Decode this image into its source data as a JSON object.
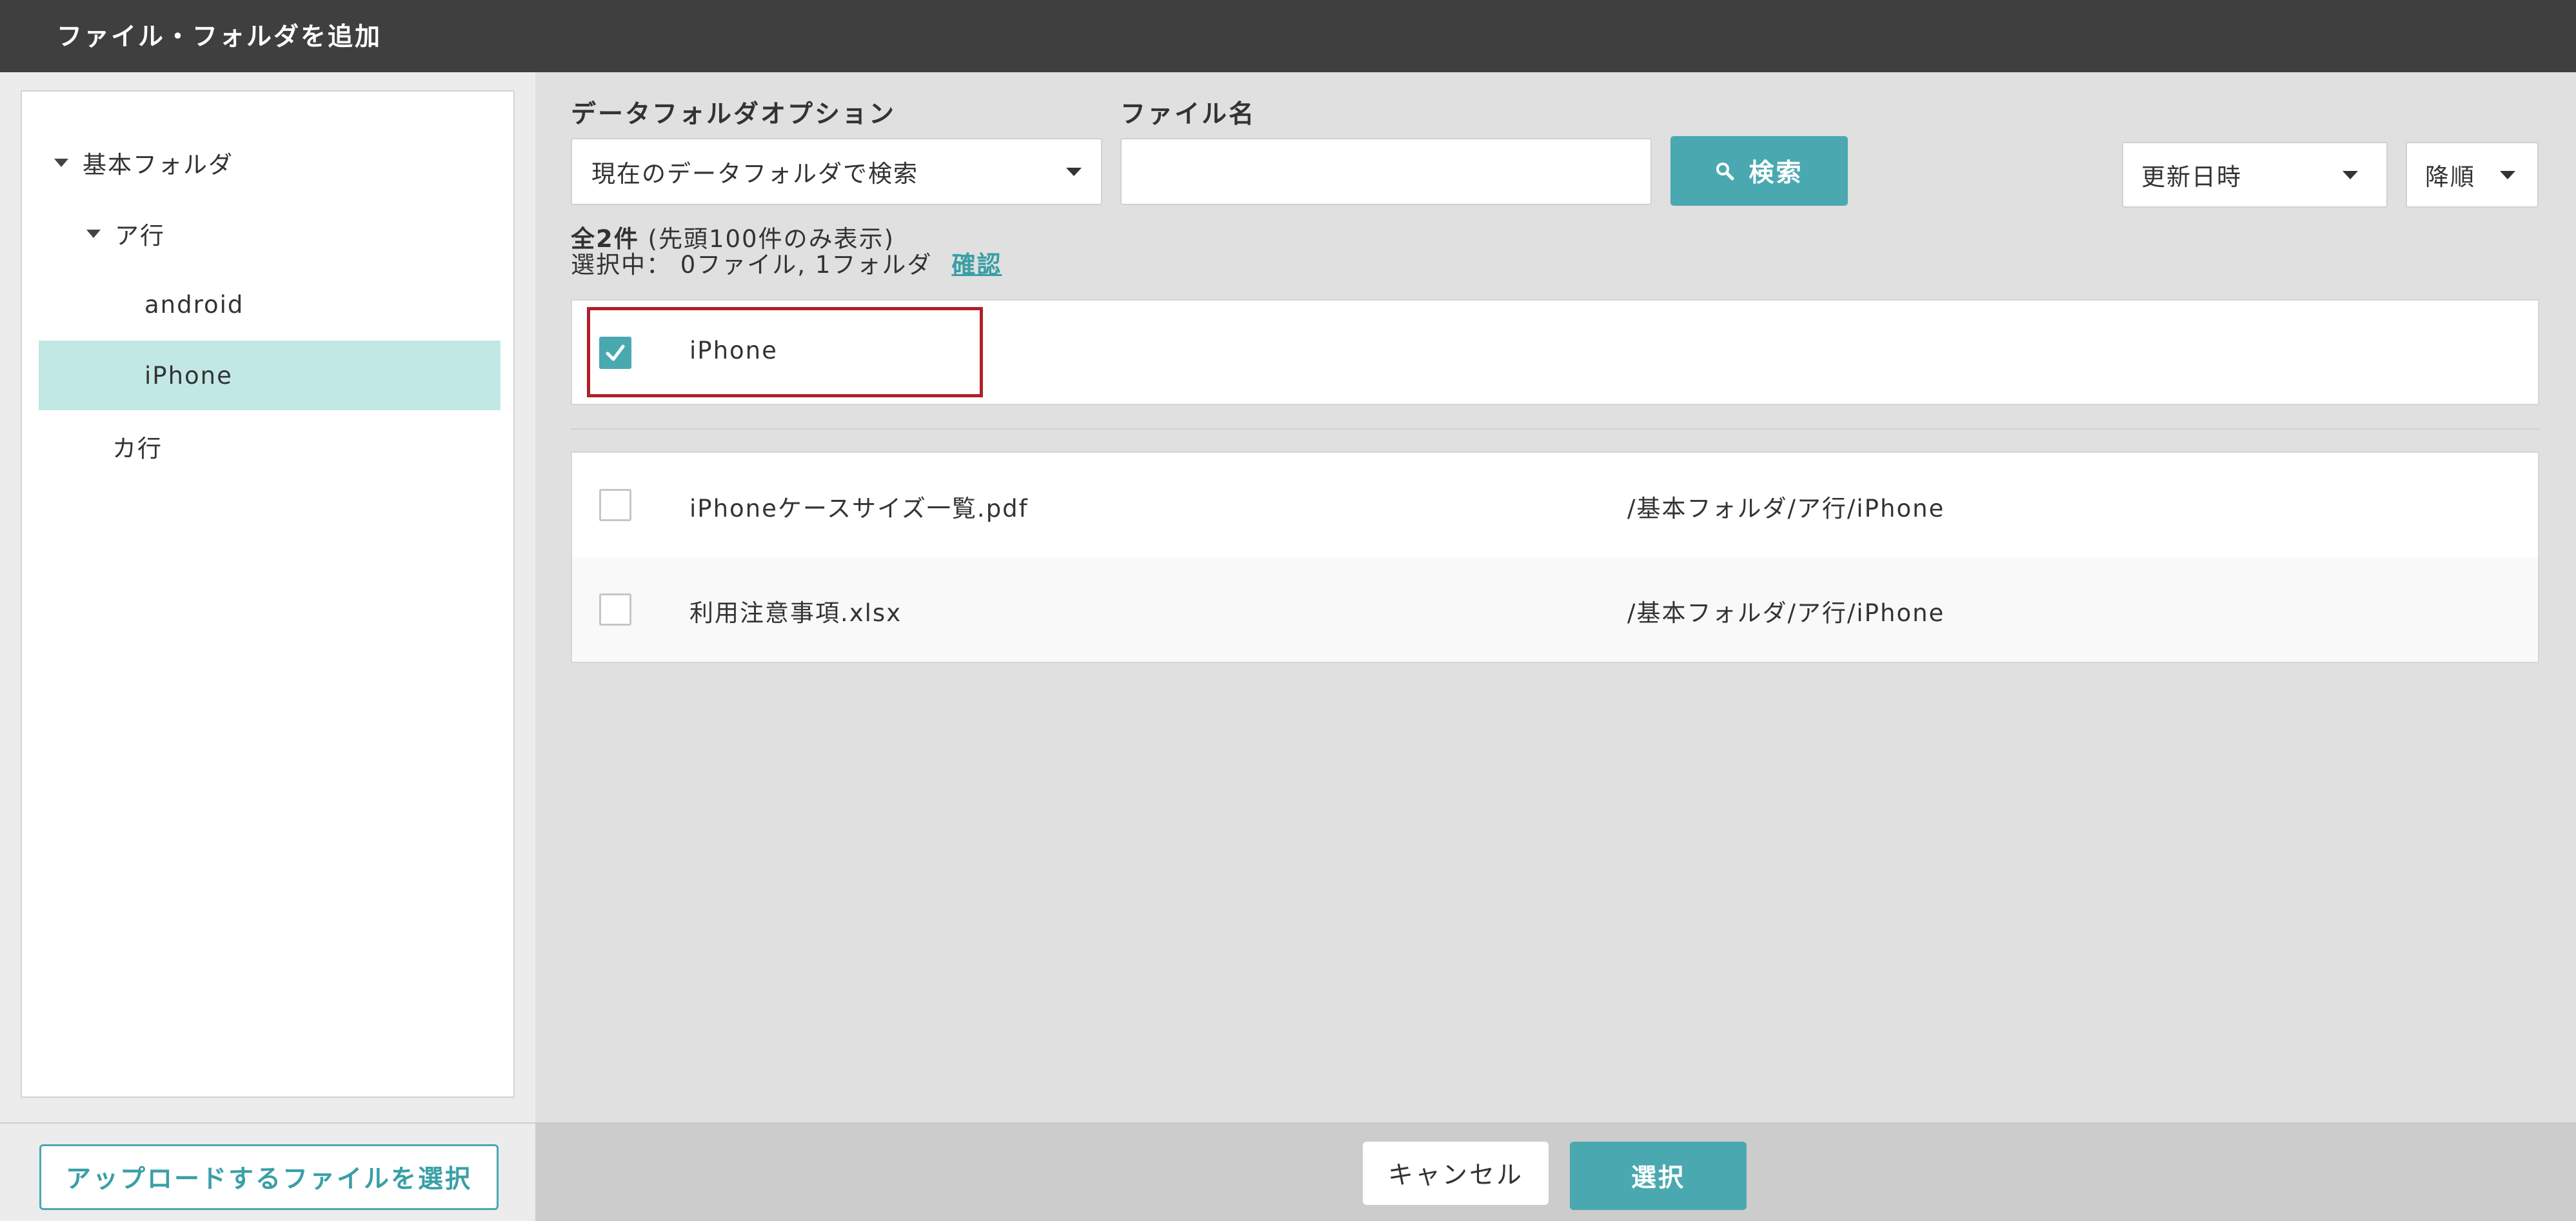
{
  "window": {
    "title": "ファイル・フォルダを追加"
  },
  "tree": {
    "items": [
      {
        "label": "基本フォルダ",
        "expanded": true,
        "selected": false
      },
      {
        "label": "ア行",
        "expanded": true,
        "selected": false
      },
      {
        "label": "android",
        "selected": false
      },
      {
        "label": "iPhone",
        "selected": true
      },
      {
        "label": "カ行",
        "selected": false
      }
    ]
  },
  "sidebar": {
    "upload_label": "アップロードするファイルを選択"
  },
  "filters": {
    "folder_option_label": "データフォルダオプション",
    "folder_option_value": "現在のデータフォルダで検索",
    "filename_label": "ファイル名",
    "filename_value": "",
    "search_label": "検索",
    "sort_field": "更新日時",
    "sort_order": "降順"
  },
  "summary": {
    "total_prefix": "全2件",
    "total_suffix": "(先頭100件のみ表示)",
    "selected_text": "選択中： 0ファイル, 1フォルダ",
    "confirm_link": "確認"
  },
  "folder_results": [
    {
      "name": "iPhone",
      "checked": true
    }
  ],
  "file_results": [
    {
      "name": "iPhoneケースサイズ一覧.pdf",
      "path": "/基本フォルダ/ア行/iPhone",
      "checked": false
    },
    {
      "name": "利用注意事項.xlsx",
      "path": "/基本フォルダ/ア行/iPhone",
      "checked": false
    }
  ],
  "footer": {
    "cancel_label": "キャンセル",
    "select_label": "選択"
  },
  "colors": {
    "accent": "#4aa9b0",
    "titlebar": "#3f3f3f",
    "selected_bg": "#c2e8e6",
    "highlight": "#b0202a"
  }
}
